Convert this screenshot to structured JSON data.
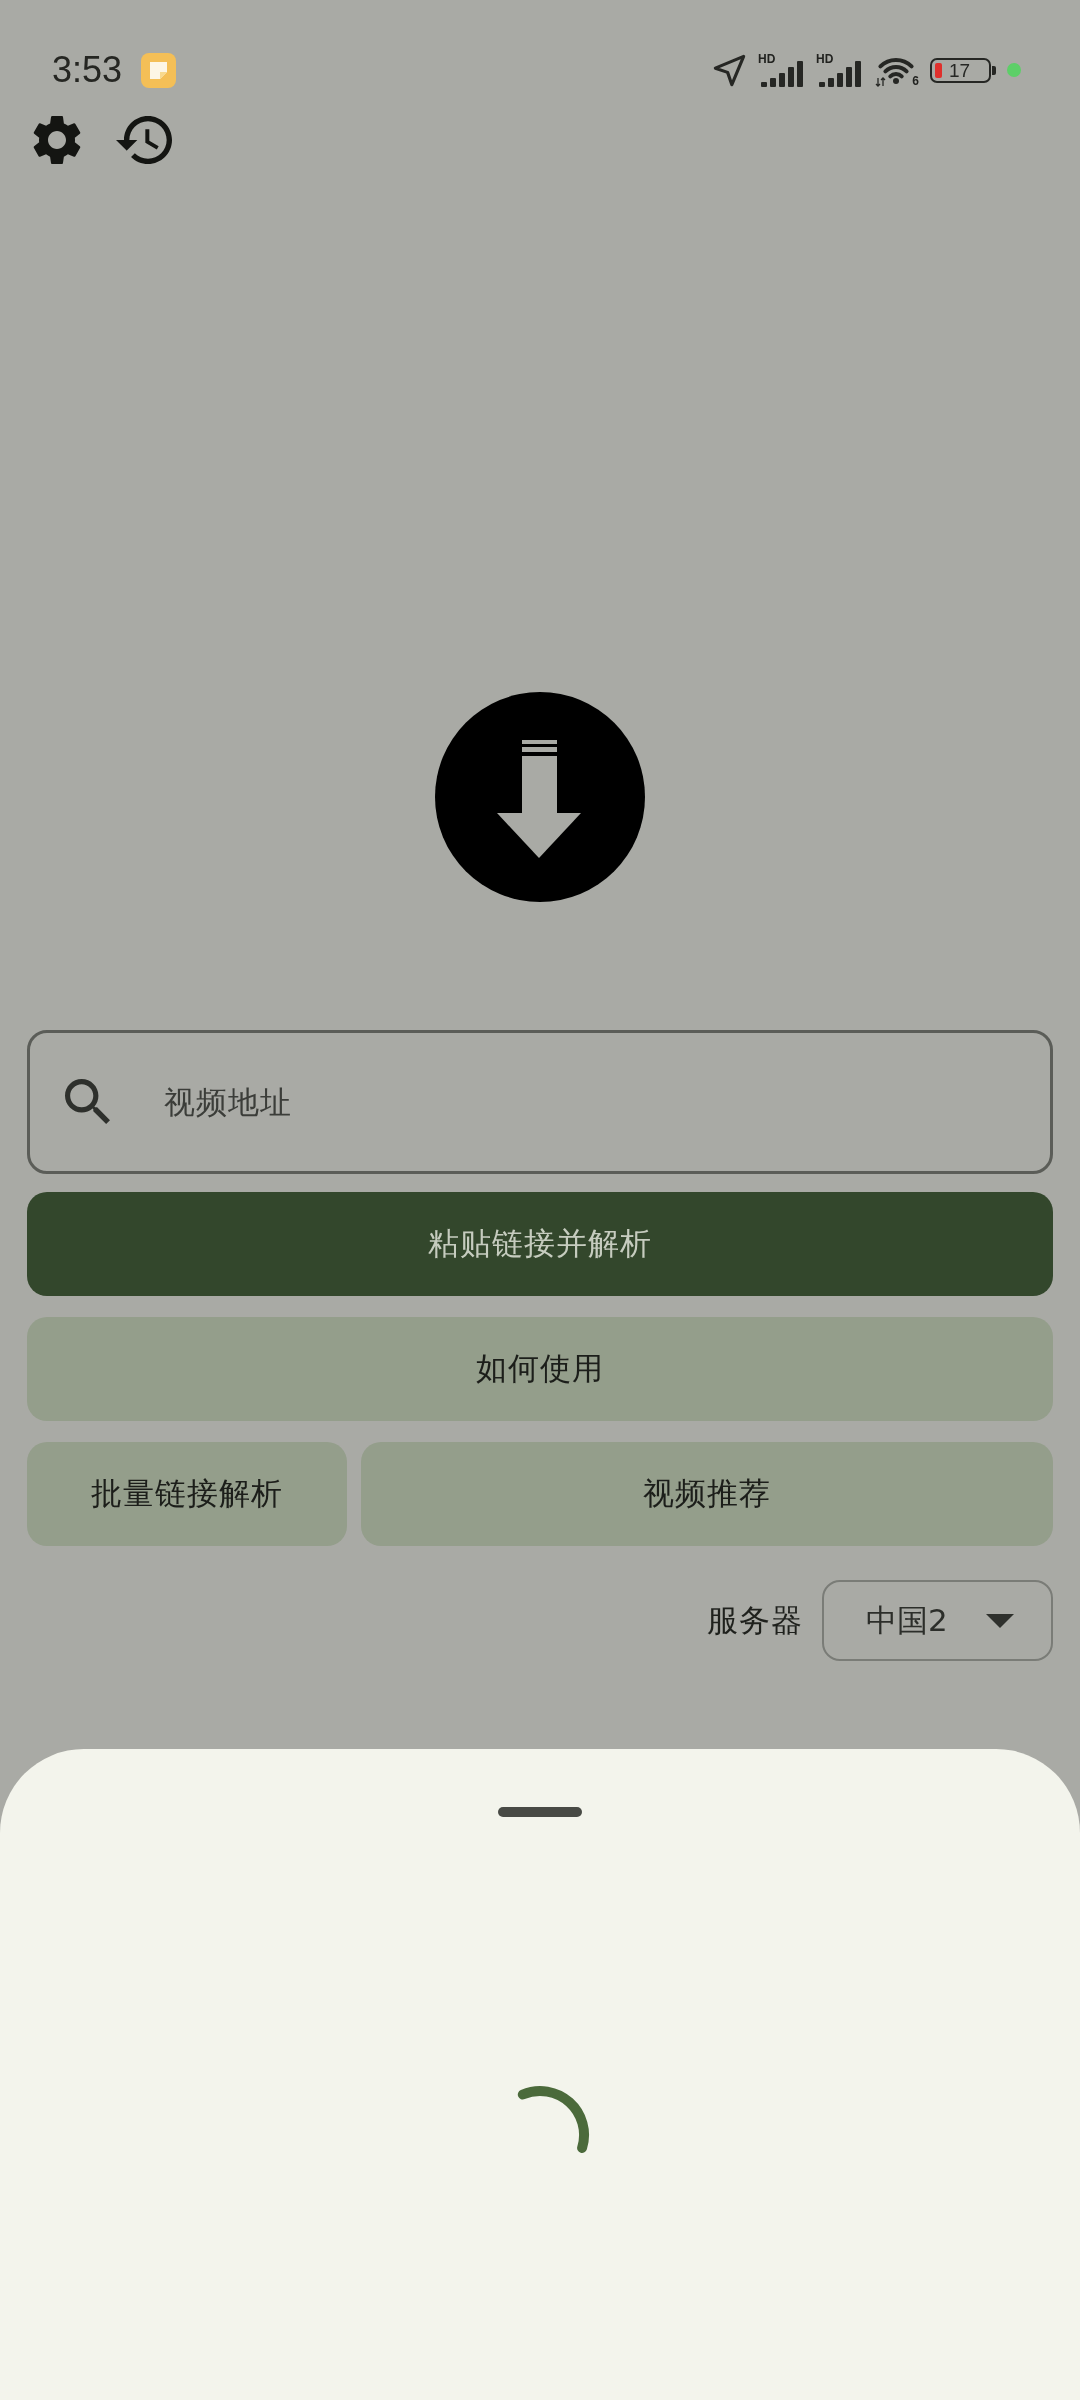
{
  "status_bar": {
    "time": "3:53",
    "network_labels": [
      "HD",
      "HD"
    ],
    "wifi_label": "6",
    "battery": "17"
  },
  "search_field": {
    "placeholder": "视频地址"
  },
  "action_rows": [
    [
      {
        "label": "粘贴链接并解析",
        "kind": "primary"
      }
    ],
    [
      {
        "label": "如何使用",
        "kind": "tonal"
      }
    ],
    [
      {
        "label": "批量链接解析",
        "kind": "tonal"
      },
      {
        "label": "视频推荐",
        "kind": "tonal"
      }
    ]
  ],
  "server": {
    "label": "服务器",
    "value": "中国2"
  },
  "bottom_sheet": {
    "loading": true
  }
}
